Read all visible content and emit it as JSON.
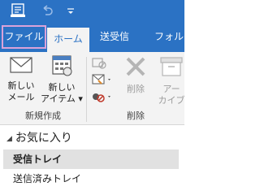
{
  "quick_access": {
    "icons": [
      "send-receive-all-folders-icon",
      "undo-icon",
      "customize-toolbar-icon"
    ]
  },
  "tabs": {
    "file": "ファイル",
    "home": "ホーム",
    "send_receive": "送受信",
    "folder": "フォルダ"
  },
  "ribbon": {
    "new_group": {
      "label": "新規作成",
      "new_mail_line1": "新しい",
      "new_mail_line2": "メール",
      "new_items_line1": "新しい",
      "new_items_line2": "アイテム ▾"
    },
    "delete_group": {
      "label": "削除",
      "delete": "削除",
      "archive_line1": "アー",
      "archive_line2": "カイブ"
    }
  },
  "folder_pane": {
    "favorites": "お気に入り",
    "folders": [
      "受信トレイ",
      "送信済みトレイ"
    ]
  },
  "colors": {
    "accent": "#2b72c4",
    "ribbon_bg": "#f3f3f3",
    "file_tab_highlight": "#d9a2d9",
    "selected_folder_bg": "#e1e1e1"
  }
}
